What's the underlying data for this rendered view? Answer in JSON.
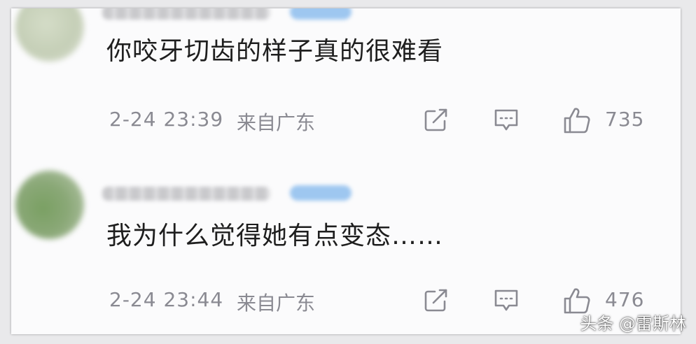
{
  "comments": [
    {
      "text": "你咬牙切齿的样子真的很难看",
      "timestamp": "2-24 23:39",
      "location": "来自广东",
      "like_count": "735",
      "icons": [
        "share-icon",
        "reply-icon",
        "like-icon"
      ]
    },
    {
      "text": "我为什么觉得她有点变态……",
      "timestamp": "2-24 23:44",
      "location": "来自广东",
      "like_count": "476",
      "icons": [
        "share-icon",
        "reply-icon",
        "like-icon"
      ]
    }
  ],
  "watermark": "头条 @雷斯林",
  "colors": {
    "background": "#fbfbfc",
    "text": "#1e1e1e",
    "meta": "#8a8a92",
    "badge": "#9ec7f0"
  }
}
